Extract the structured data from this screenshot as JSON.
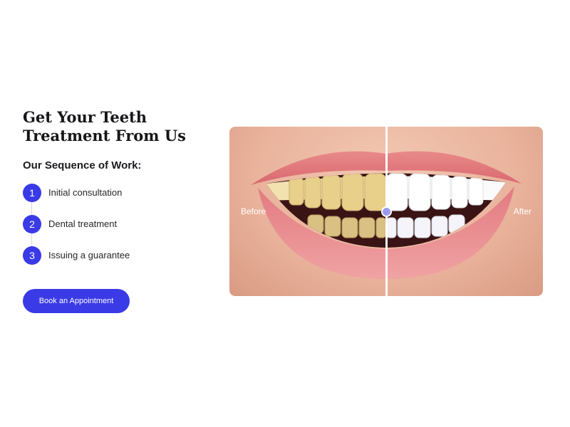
{
  "heading": "Get Your Teeth Treatment From Us",
  "subheading": "Our Sequence of Work:",
  "steps": [
    {
      "number": "1",
      "label": "Initial consultation"
    },
    {
      "number": "2",
      "label": "Dental treatment"
    },
    {
      "number": "3",
      "label": "Issuing a guarantee"
    }
  ],
  "cta": {
    "label": "Book an Appointment"
  },
  "comparison": {
    "before_label": "Before",
    "after_label": "After",
    "slider_position": 0.5
  },
  "colors": {
    "accent": "#3a3ae6",
    "handle": "#9a9cf0"
  }
}
